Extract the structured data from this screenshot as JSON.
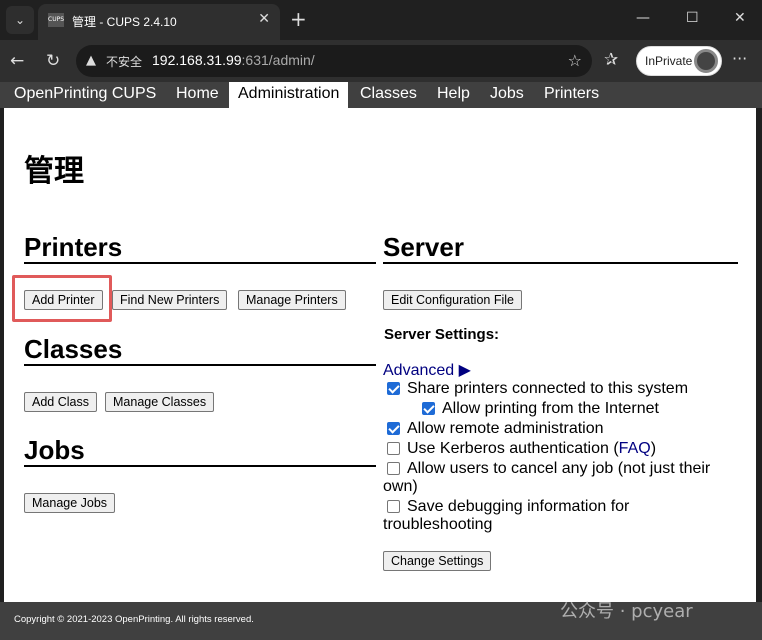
{
  "browser": {
    "tab_title": "管理 - CUPS 2.4.10",
    "favicon_text": "CUPS",
    "address": {
      "insecure_label": "不安全",
      "host": "192.168.31.99",
      "rest": ":631/admin/"
    },
    "inprivate_label": "InPrivate"
  },
  "cups_nav": {
    "items": [
      "OpenPrinting CUPS",
      "Home",
      "Administration",
      "Classes",
      "Help",
      "Jobs",
      "Printers"
    ],
    "active": "Administration"
  },
  "page": {
    "title": "管理",
    "printers": {
      "heading": "Printers",
      "buttons": [
        "Add Printer",
        "Find New Printers",
        "Manage Printers"
      ]
    },
    "classes": {
      "heading": "Classes",
      "buttons": [
        "Add Class",
        "Manage Classes"
      ]
    },
    "jobs": {
      "heading": "Jobs",
      "buttons": [
        "Manage Jobs"
      ]
    },
    "server": {
      "heading": "Server",
      "edit_config_button": "Edit Configuration File",
      "settings_label": "Server Settings:",
      "advanced_link": "Advanced ▶",
      "options": [
        {
          "label": "Share printers connected to this system",
          "checked": true
        },
        {
          "label": "Allow printing from the Internet",
          "checked": true
        },
        {
          "label": "Allow remote administration",
          "checked": true
        },
        {
          "label": "Use Kerberos authentication (",
          "link": "FAQ",
          "suffix": ")",
          "checked": false
        },
        {
          "label": "Allow users to cancel any job (not just their",
          "label2": "own)",
          "checked": false
        },
        {
          "label": "Save debugging information for",
          "label2": "troubleshooting",
          "checked": false
        }
      ],
      "change_settings_button": "Change Settings"
    }
  },
  "footer": {
    "copyright": "Copyright © 2021-2023 OpenPrinting. All rights reserved."
  },
  "watermark": "公众号 · pcyear",
  "colors": {
    "nav_bg": "#404040",
    "link": "#000080",
    "highlight": "#e05a5a",
    "checkbox": "#1e6bd6"
  }
}
